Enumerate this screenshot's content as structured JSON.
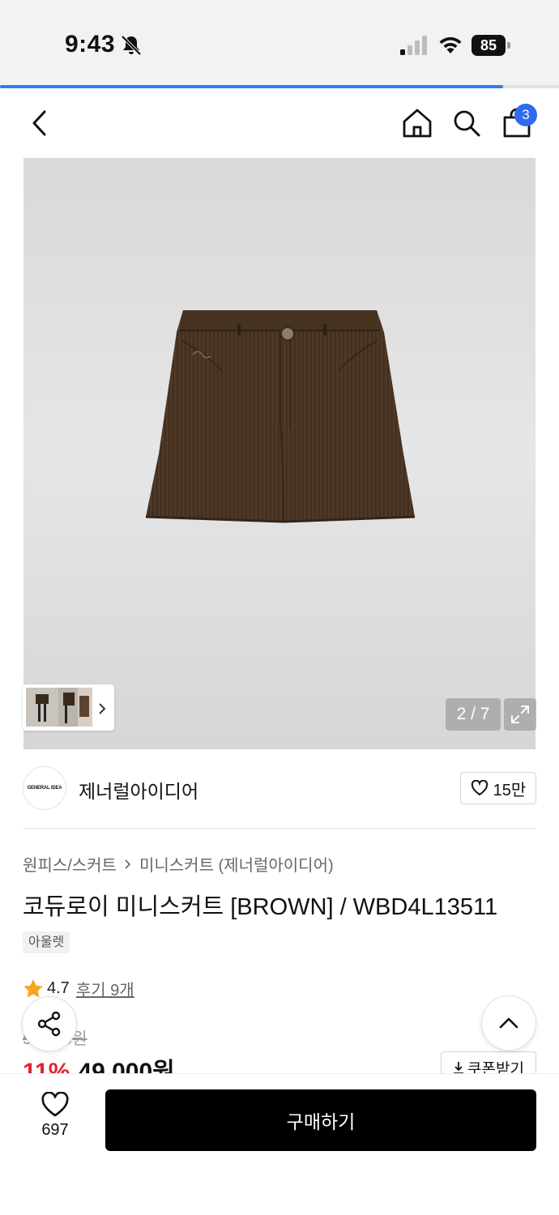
{
  "status_bar": {
    "time": "9:43",
    "battery": "85",
    "icons": [
      "bell-slash-icon",
      "signal-icon",
      "wifi-icon",
      "battery-icon"
    ]
  },
  "page_progress": 0.9,
  "nav": {
    "icons": [
      "back-icon",
      "home-icon",
      "search-icon",
      "cart-icon"
    ],
    "cart_count": "3"
  },
  "gallery": {
    "counter": "2 / 7",
    "colors": {
      "background": "#dcdcdd",
      "skirt": "#4e3826"
    }
  },
  "brand": {
    "logo_text": "GENERAL IDEA",
    "name": "제너럴아이디어",
    "likes": "15만"
  },
  "product": {
    "breadcrumb": [
      "원피스/스커트",
      "미니스커트 (제너럴아이디어)"
    ],
    "title": "코듀로이 미니스커트 [BROWN] / WBD4L13511",
    "tag": "아울렛",
    "rating": "4.7",
    "review_link": "후기 9개",
    "original_price": "55,000원",
    "discount": "11%",
    "price": "49,000원",
    "coupon_label": "쿠폰받기"
  },
  "bottom_bar": {
    "wish_count": "697",
    "buy_label": "구매하기"
  },
  "colors": {
    "accent": "#2f80ed",
    "badge": "#2f6bf0",
    "discount": "#e3262f",
    "star": "#f5a623",
    "buy_button": "#000000"
  }
}
